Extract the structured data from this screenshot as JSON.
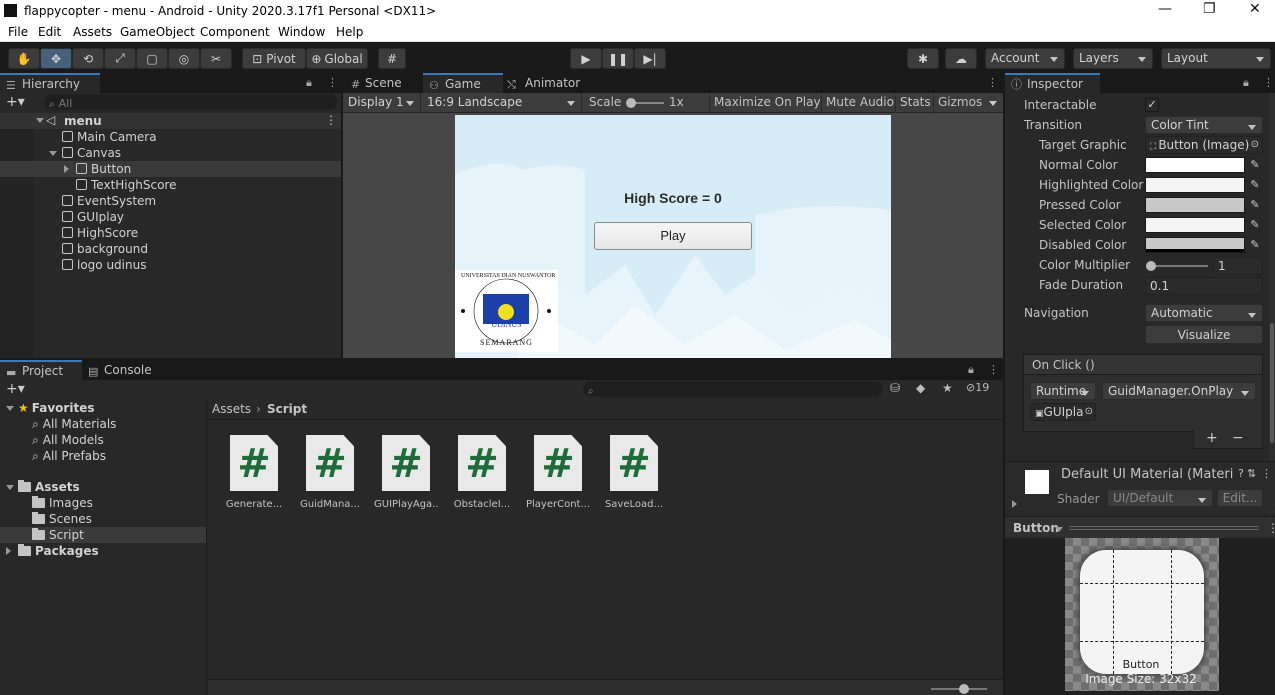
{
  "window": {
    "title": "flappycopter - menu - Android - Unity 2020.3.17f1 Personal <DX11>",
    "minimize": "—",
    "restore": "❐",
    "close": "✕"
  },
  "menu": [
    "File",
    "Edit",
    "Assets",
    "GameObject",
    "Component",
    "Window",
    "Help"
  ],
  "toolbar": {
    "pivot": "Pivot",
    "global": "Global",
    "account": "Account",
    "layers": "Layers",
    "layout": "Layout"
  },
  "hierarchy": {
    "tab": "Hierarchy",
    "search_placeholder": "All",
    "scene": "menu",
    "items": [
      "Main Camera",
      "Canvas",
      "Button",
      "TextHighScore",
      "EventSystem",
      "GUIplay",
      "HighScore",
      "background",
      "logo udinus"
    ]
  },
  "game_view": {
    "tabs": [
      "Scene",
      "Game",
      "Animator"
    ],
    "display": "Display 1",
    "aspect": "16:9 Landscape",
    "scale_label": "Scale",
    "scale_value": "1x",
    "toggles": [
      "Maximize On Play",
      "Mute Audio",
      "Stats",
      "Gizmos"
    ],
    "high_score": "High Score = 0",
    "play_button": "Play",
    "logo_top": "UNIVERSITAS DIAN NUSWANTORO",
    "logo_mid": "UDINUS",
    "logo_bottom": "SEMARANG"
  },
  "project": {
    "tabs": [
      "Project",
      "Console"
    ],
    "hidden_count": "19",
    "favorites": "Favorites",
    "favorites_items": [
      "All Materials",
      "All Models",
      "All Prefabs"
    ],
    "assets": "Assets",
    "assets_items": [
      "Images",
      "Scenes",
      "Script"
    ],
    "packages": "Packages",
    "breadcrumb_root": "Assets",
    "breadcrumb_current": "Script",
    "files": [
      "Generate...",
      "GuidMana...",
      "GUIPlayAga...",
      "ObstacleI...",
      "PlayerCont...",
      "SaveLoad..."
    ],
    "file_glyph": "#"
  },
  "inspector": {
    "tab": "Inspector",
    "interactable": "Interactable",
    "transition": "Transition",
    "transition_value": "Color Tint",
    "target_graphic": "Target Graphic",
    "target_graphic_value": "Button (Image)",
    "normal": "Normal Color",
    "highlighted": "Highlighted Color",
    "pressed": "Pressed Color",
    "selected": "Selected Color",
    "disabled": "Disabled Color",
    "multiplier": "Color Multiplier",
    "multiplier_value": "1",
    "fade": "Fade Duration",
    "fade_value": "0.1",
    "navigation": "Navigation",
    "navigation_value": "Automatic",
    "visualize": "Visualize",
    "onclick": "On Click ()",
    "runtime": "Runtime",
    "function": "GuidManager.OnPlay",
    "object": "GUIpla",
    "plus": "+",
    "minus": "−",
    "material_name": "Default UI Material (Materi",
    "shader_label": "Shader",
    "shader_value": "UI/Default",
    "edit": "Edit...",
    "preview_title": "Button",
    "preview_caption": "Button",
    "image_size": "Image Size: 32x32"
  },
  "colors": {
    "accent": "#3a79bb",
    "panel": "#282828",
    "sky": "#d6ecf6"
  }
}
